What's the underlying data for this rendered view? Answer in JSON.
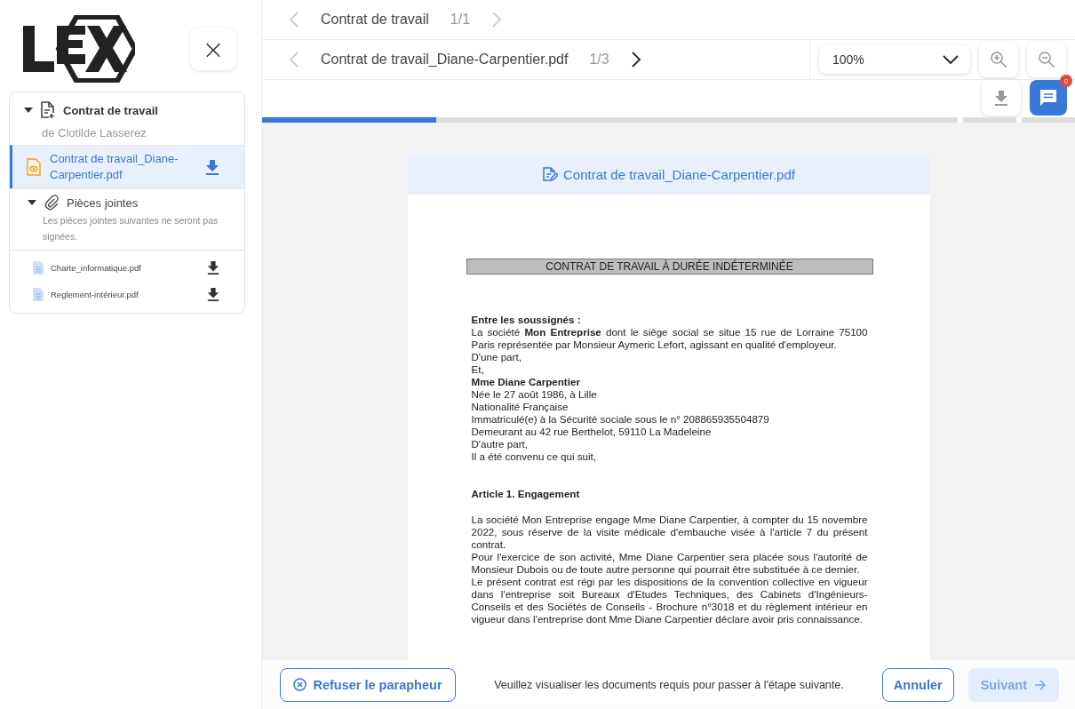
{
  "sidebar": {
    "close_label": "×",
    "tree": {
      "label": "Contrat de travail",
      "expanded": true,
      "subtitle": "de Clotilde Lasserez",
      "documents": [
        {
          "label": "Contrat de travail_Diane-Carpentier.pdf",
          "selected": true
        }
      ],
      "attachments": {
        "label": "Pièces jointes",
        "expanded": true,
        "note": "Les pièces jointes suivantes ne seront pas signées.",
        "files": [
          {
            "label": "Charte_informatique.pdf"
          },
          {
            "label": "Reglement-intérieur.pdf"
          }
        ]
      }
    }
  },
  "nav": [
    {
      "title": "Contrat de travail",
      "counter": "1/1",
      "prev_enabled": false,
      "next_enabled": false
    },
    {
      "title": "Contrat de travail_Diane-Carpentier.pdf",
      "counter": "1/3",
      "prev_enabled": false,
      "next_enabled": true
    }
  ],
  "zoom": {
    "value": "100%"
  },
  "comments": {
    "count": "0"
  },
  "progress": {
    "level": 0.25
  },
  "document": {
    "header": "Contrat de travail_Diane-Carpentier.pdf",
    "title": "CONTRAT DE TRAVAIL À DURÉE INDÉTERMINÉE",
    "blocks": [
      {
        "kind": "lines",
        "lines": [
          {
            "text": "Entre les soussignés :",
            "bold": true
          },
          {
            "text": "La société **Mon Entreprise** dont le siège social se situe 15 rue de Lorraine 75100 Paris représentée par Monsieur Aymeric Lefort, agissant en qualité d'employeur.",
            "bold": false
          },
          {
            "text": "D'une part,",
            "bold": false
          },
          {
            "text": "Et,",
            "bold": false
          },
          {
            "text": "Mme Diane Carpentier",
            "bold": true
          },
          {
            "text": "Née le 27 août 1986, à Lille",
            "bold": false
          },
          {
            "text": "Nationalité Française",
            "bold": false
          },
          {
            "text": "Immatriculé(e) à la Sécurité sociale sous le n° 208865935504879",
            "bold": false
          },
          {
            "text": "Demeurant au 42 rue Berthelot, 59110 La Madeleine",
            "bold": false
          },
          {
            "text": "D'autre part,",
            "bold": false
          },
          {
            "text": "Il a été convenu ce qui suit,",
            "bold": false
          }
        ]
      },
      {
        "kind": "heading",
        "text": "Article 1. Engagement"
      },
      {
        "kind": "lines",
        "lines": [
          {
            "text": "La société Mon Entreprise engage Mme Diane Carpentier, à compter du 15 novembre 2022, sous réserve de la visite médicale d'embauche visée à l'article 7 du présent contrat.",
            "bold": false
          },
          {
            "text": "Pour l'exercice de son activité, Mme Diane Carpentier sera placée sous l'autorité de Monsieur Dubois ou de toute autre personne qui pourrait être substituée à ce dernier.",
            "bold": false
          },
          {
            "text": "Le présent contrat est régi par les dispositions de la convention collective en vigueur dans l'entreprise soit Bureaux d'Etudes Techniques, des Cabinets d'Ingénieurs-Conseils et des Sociétés de Conseils - Brochure n°3018 et du règlement intérieur en vigueur dans l'entreprise dont Mme Diane Carpentier déclare avoir pris connaissance.",
            "bold": false
          }
        ]
      }
    ]
  },
  "footer": {
    "refuse": "Refuser le parapheur",
    "message": "Veuillez visualiser les documents requis pour passer à l'étape suivante.",
    "cancel": "Annuler",
    "next": {
      "label": "Suivant",
      "disabled": true
    }
  }
}
